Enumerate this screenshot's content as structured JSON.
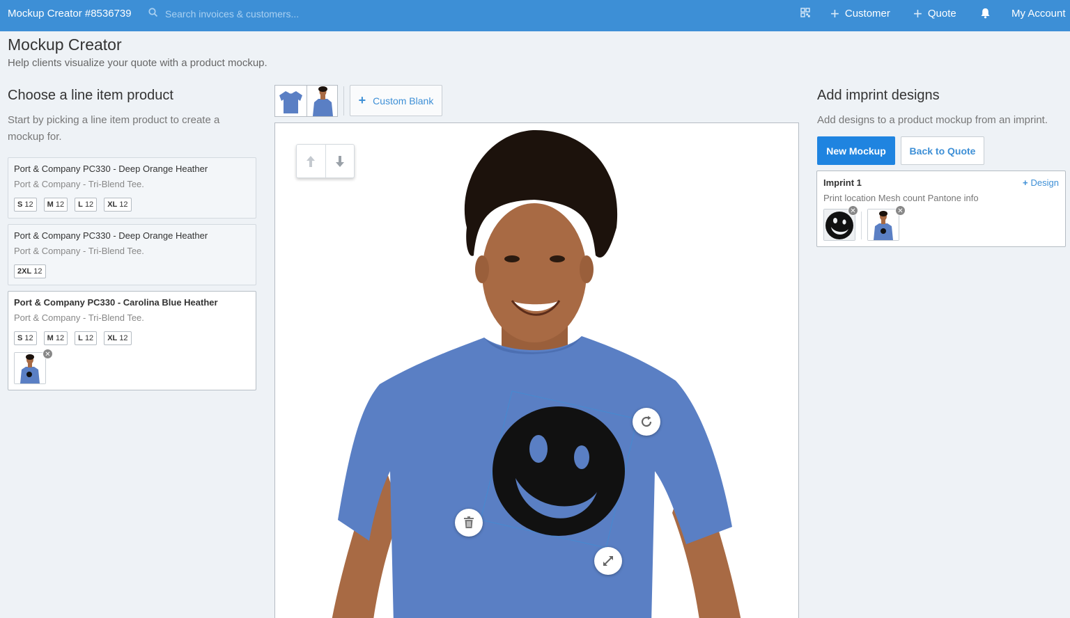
{
  "topbar": {
    "app_title": "Mockup Creator #8536739",
    "search_placeholder": "Search invoices & customers...",
    "customer_label": "Customer",
    "quote_label": "Quote",
    "account_label": "My Account"
  },
  "header": {
    "title": "Mockup Creator",
    "subtitle": "Help clients visualize your quote with a product mockup."
  },
  "left": {
    "title": "Choose a line item product",
    "description": "Start by picking a line item product to create a mockup for.",
    "products": [
      {
        "name": "Port & Company PC330 - Deep Orange Heather",
        "subtitle": "Port & Company - Tri-Blend Tee.",
        "sizes": [
          {
            "size": "S",
            "qty": "12"
          },
          {
            "size": "M",
            "qty": "12"
          },
          {
            "size": "L",
            "qty": "12"
          },
          {
            "size": "XL",
            "qty": "12"
          }
        ]
      },
      {
        "name": "Port & Company PC330 - Deep Orange Heather",
        "subtitle": "Port & Company - Tri-Blend Tee.",
        "sizes": [
          {
            "size": "2XL",
            "qty": "12"
          }
        ]
      },
      {
        "name": "Port & Company PC330 - Carolina Blue Heather",
        "subtitle": "Port & Company - Tri-Blend Tee.",
        "sizes": [
          {
            "size": "S",
            "qty": "12"
          },
          {
            "size": "M",
            "qty": "12"
          },
          {
            "size": "L",
            "qty": "12"
          },
          {
            "size": "XL",
            "qty": "12"
          }
        ],
        "selected": true
      }
    ]
  },
  "middle": {
    "custom_blank_label": "Custom Blank"
  },
  "right": {
    "title": "Add imprint designs",
    "description": "Add designs to a product mockup from an imprint.",
    "new_mockup_label": "New Mockup",
    "back_to_quote_label": "Back to Quote",
    "imprint": {
      "title": "Imprint 1",
      "info": "Print location Mesh count Pantone info",
      "add_design_label": "Design"
    }
  },
  "colors": {
    "topbar": "#3d8fd6",
    "primary": "#1f84e0",
    "shirt": "#5a7fc4",
    "skin": "#a86a44",
    "hair": "#1c120c"
  }
}
